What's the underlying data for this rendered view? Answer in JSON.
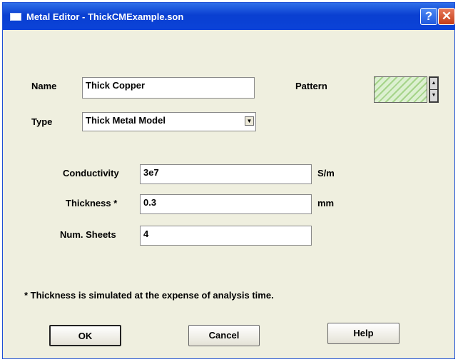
{
  "window": {
    "title": "Metal Editor - ThickCMExample.son",
    "help_btn": "?",
    "close_btn": "✕"
  },
  "form": {
    "name_label": "Name",
    "name_value": "Thick Copper",
    "pattern_label": "Pattern",
    "type_label": "Type",
    "type_value": "Thick Metal Model",
    "conductivity_label": "Conductivity",
    "conductivity_value": "3e7",
    "conductivity_unit": "S/m",
    "thickness_label": "Thickness *",
    "thickness_value": "0.3",
    "thickness_unit": "mm",
    "sheets_label": "Num. Sheets",
    "sheets_value": "4"
  },
  "note": "* Thickness is simulated at the expense of analysis time.",
  "buttons": {
    "ok": "OK",
    "cancel": "Cancel",
    "help": "Help"
  }
}
